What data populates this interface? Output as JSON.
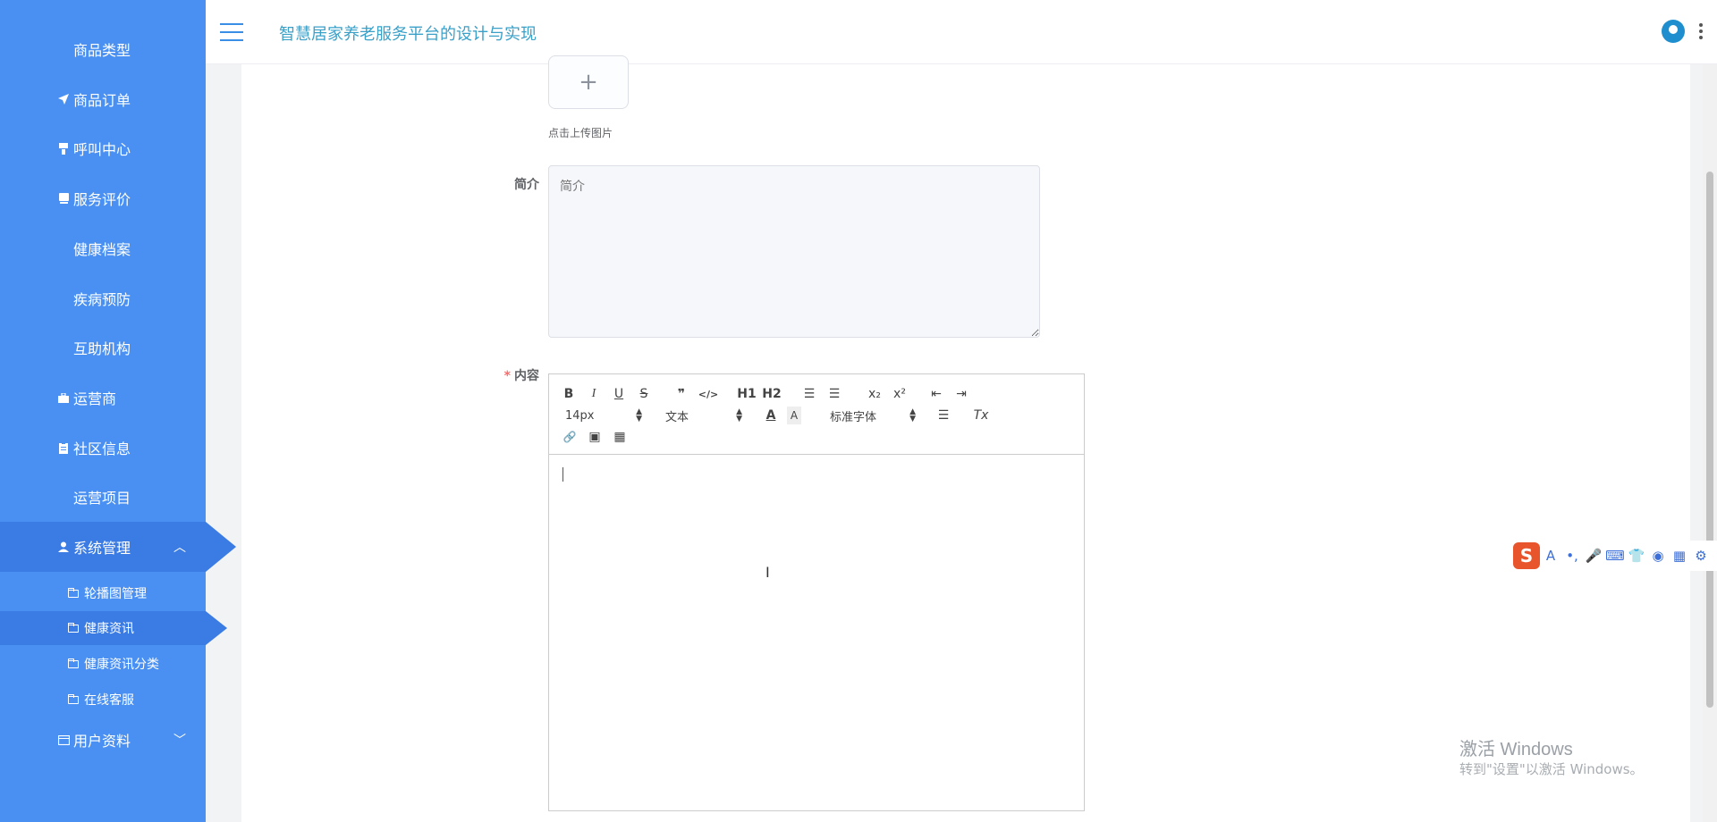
{
  "header": {
    "title": "智慧居家养老服务平台的设计与实现"
  },
  "sidebar": {
    "items": [
      {
        "label": "商品类型",
        "icon": "grid-icon"
      },
      {
        "label": "商品订单",
        "icon": "send-icon"
      },
      {
        "label": "呼叫中心",
        "icon": "pager-icon"
      },
      {
        "label": "服务评价",
        "icon": "comment-icon"
      },
      {
        "label": "健康档案",
        "icon": "grid-icon"
      },
      {
        "label": "疾病预防",
        "icon": "grid-icon"
      },
      {
        "label": "互助机构",
        "icon": "grid-icon"
      },
      {
        "label": "运营商",
        "icon": "briefcase-icon"
      },
      {
        "label": "社区信息",
        "icon": "clipboard-icon"
      },
      {
        "label": "运营项目",
        "icon": "grid-icon"
      }
    ],
    "active": {
      "label": "系统管理",
      "icon": "user-icon"
    },
    "submenu": [
      {
        "label": "轮播图管理"
      },
      {
        "label": "健康资讯"
      },
      {
        "label": "健康资讯分类"
      },
      {
        "label": "在线客服"
      }
    ],
    "last": {
      "label": "用户资料",
      "icon": "id-card-icon"
    }
  },
  "form": {
    "upload_hint": "点击上传图片",
    "upload_plus": "+",
    "intro_label": "简介",
    "intro_placeholder": "简介",
    "content_label": "内容",
    "required_mark": "*"
  },
  "editor": {
    "bold": "B",
    "italic": "I",
    "underline": "U",
    "strike": "S",
    "quote": "❞",
    "code": "</>",
    "h1": "H1",
    "h2": "H2",
    "ordered_list": "☰",
    "bullet_list": "☰",
    "subscript": "x₂",
    "superscript": "x²",
    "outdent": "⇤",
    "indent": "⇥",
    "size_value": "14px",
    "header_value": "文本",
    "color_label": "A",
    "bg_label": "A",
    "font_value": "标准字体",
    "align_label": "☰",
    "clean_label": "Tx",
    "link": "🔗",
    "image": "▣",
    "video": "▦",
    "ibeam": "I"
  },
  "watermark": {
    "line1": "激活 Windows",
    "line2": "转到\"设置\"以激活 Windows。"
  },
  "ime": {
    "logo": "S",
    "icons": [
      "A",
      "•,",
      "🎤",
      "⌨",
      "👕",
      "◉",
      "▦",
      "⚙"
    ]
  }
}
